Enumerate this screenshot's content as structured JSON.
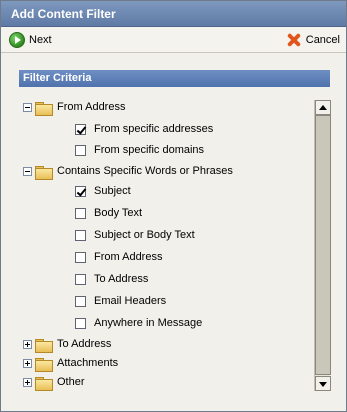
{
  "window": {
    "title": "Add Content Filter"
  },
  "toolbar": {
    "next_label": "Next",
    "cancel_label": "Cancel"
  },
  "section": {
    "title": "Filter Criteria"
  },
  "tree": {
    "groups": [
      {
        "label": "From Address",
        "expanded": true,
        "items": [
          {
            "label": "From specific addresses",
            "checked": true
          },
          {
            "label": "From specific domains",
            "checked": false
          }
        ]
      },
      {
        "label": "Contains Specific Words or Phrases",
        "expanded": true,
        "items": [
          {
            "label": "Subject",
            "checked": true
          },
          {
            "label": "Body Text",
            "checked": false
          },
          {
            "label": "Subject or Body Text",
            "checked": false
          },
          {
            "label": "From Address",
            "checked": false
          },
          {
            "label": "To Address",
            "checked": false
          },
          {
            "label": "Email Headers",
            "checked": false
          },
          {
            "label": "Anywhere in Message",
            "checked": false
          }
        ]
      },
      {
        "label": "To Address",
        "expanded": false,
        "items": []
      },
      {
        "label": "Attachments",
        "expanded": false,
        "items": []
      },
      {
        "label": "Other",
        "expanded": false,
        "items": []
      }
    ]
  },
  "icons": {
    "next": "green-arrow-circle-icon",
    "cancel": "red-x-icon",
    "folder": "open-folder-icon",
    "expand": "plus-box-icon",
    "collapse": "minus-box-icon"
  },
  "colors": {
    "titlebar": "#6f89b3",
    "section_header": "#5577b1",
    "background": "#f2f0ea"
  }
}
